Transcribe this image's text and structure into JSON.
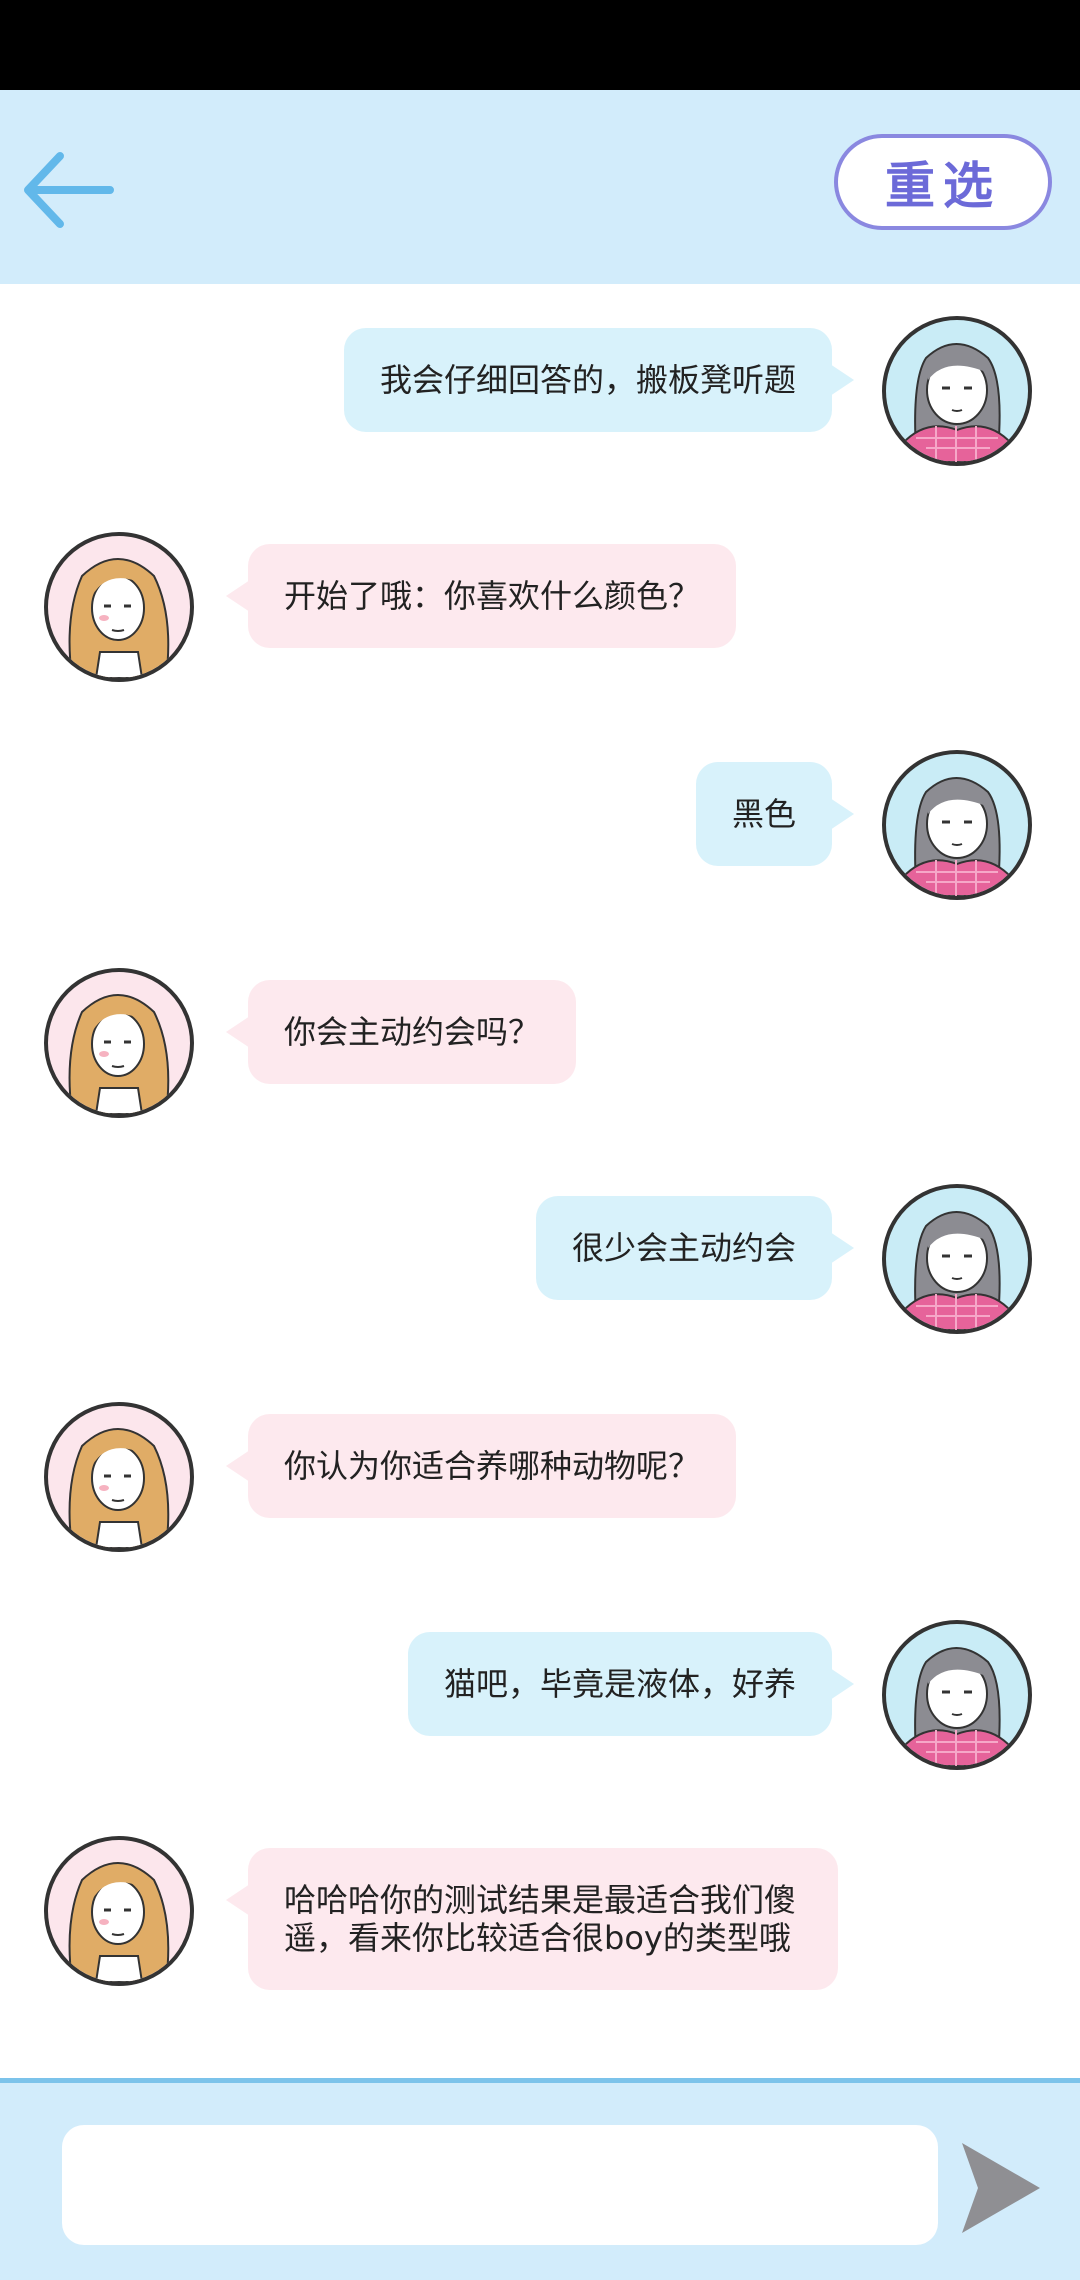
{
  "header": {
    "back_icon": "arrow-left-icon",
    "reset_label": "重选",
    "accent_color": "#7cc3ea",
    "reset_border_color": "#8a88e0"
  },
  "messages": [
    {
      "sender": "me",
      "text": "我会仔细回答的，搬板凳听题"
    },
    {
      "sender": "them",
      "text": "开始了哦：你喜欢什么颜色？"
    },
    {
      "sender": "me",
      "text": "黑色"
    },
    {
      "sender": "them",
      "text": "你会主动约会吗？"
    },
    {
      "sender": "me",
      "text": "很少会主动约会"
    },
    {
      "sender": "them",
      "text": "你认为你适合养哪种动物呢？"
    },
    {
      "sender": "me",
      "text": "猫吧，毕竟是液体，好养"
    },
    {
      "sender": "them",
      "text": "哈哈哈你的测试结果是最适合我们傻遥，看来你比较适合很boy的类型哦"
    }
  ],
  "input": {
    "value": "",
    "placeholder": "",
    "send_icon": "send-icon"
  },
  "colors": {
    "header_bg": "#d2ecfb",
    "my_bubble": "#d8f2fb",
    "their_bubble": "#fde9ee"
  }
}
